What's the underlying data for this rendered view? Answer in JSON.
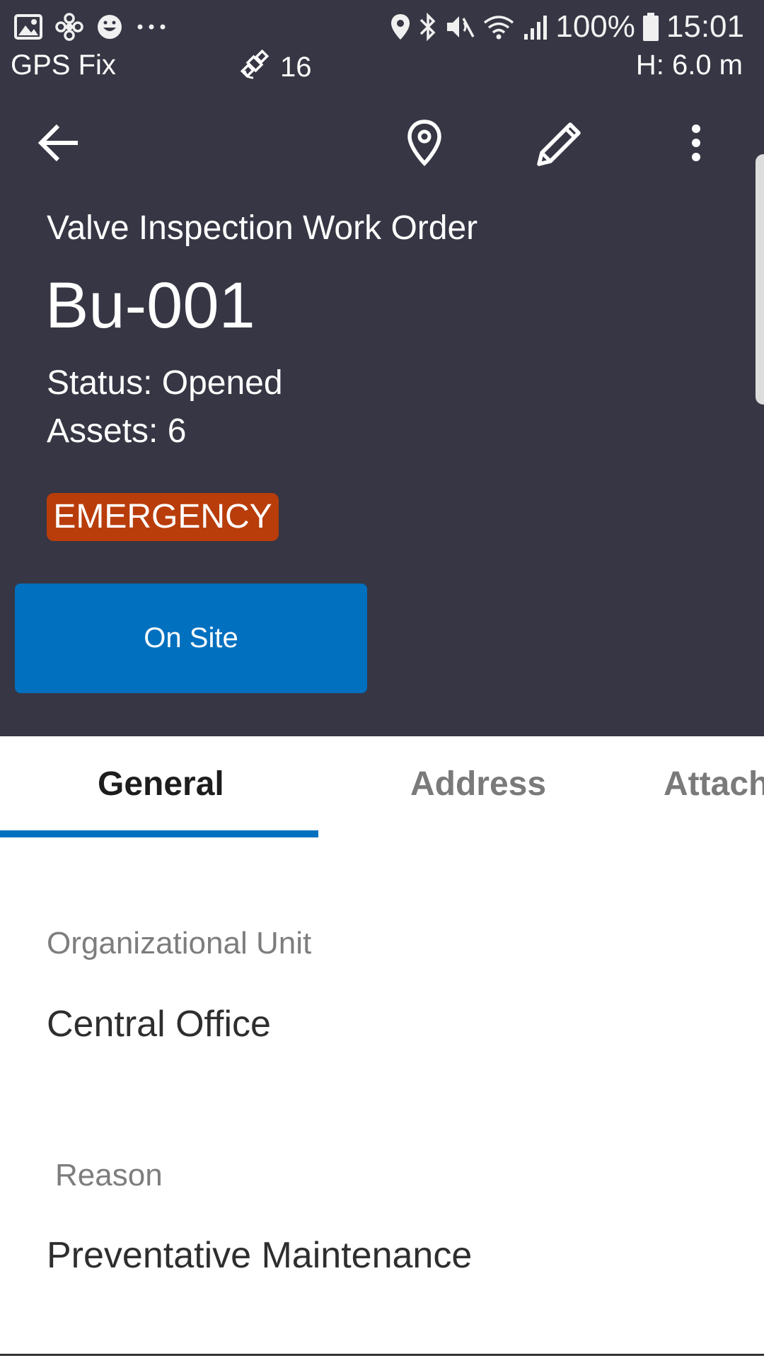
{
  "status_bar": {
    "notification_icons": [
      "gallery-icon",
      "pinwheel-icon",
      "smiley-icon",
      "more-dots-icon"
    ],
    "system_icons": [
      "location-icon",
      "bluetooth-icon",
      "mute-icon",
      "wifi-icon",
      "signal-icon",
      "battery-icon"
    ],
    "battery": "100%",
    "time": "15:01"
  },
  "gps_bar": {
    "fix_label": "GPS Fix",
    "satellite_count": "16",
    "height": "H: 6.0 m"
  },
  "toolbar": {
    "back_icon": "arrow-left-icon",
    "location_icon": "map-pin-icon",
    "edit_icon": "pencil-icon",
    "more_icon": "more-vertical-icon"
  },
  "work_order": {
    "type": "Valve Inspection Work Order",
    "id": "Bu-001",
    "status": "Status: Opened",
    "assets": "Assets: 6",
    "priority_badge": "EMERGENCY",
    "action_button": "On Site"
  },
  "tabs": [
    {
      "label": "General",
      "active": true
    },
    {
      "label": "Address",
      "active": false
    },
    {
      "label": "Attach",
      "active": false
    }
  ],
  "fields": [
    {
      "label": "Organizational Unit",
      "value": "Central Office"
    },
    {
      "label": "Reason",
      "value": "Preventative Maintenance"
    }
  ],
  "colors": {
    "header_bg": "#363644",
    "accent_blue": "#0070bf",
    "emergency_badge": "#b83d0b"
  }
}
